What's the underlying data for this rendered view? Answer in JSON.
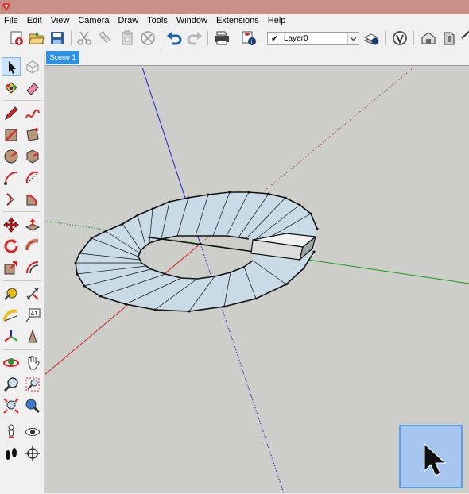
{
  "menu": [
    "File",
    "Edit",
    "View",
    "Camera",
    "Draw",
    "Tools",
    "Window",
    "Extensions",
    "Help"
  ],
  "toolbar": {
    "layer": {
      "name": "Layer0",
      "checked": true
    }
  },
  "scene_tabs": [
    {
      "label": "Scene 1"
    }
  ],
  "colors": {
    "axis_red": "#d02020",
    "axis_green": "#10a010",
    "axis_blue": "#2020c8",
    "face_fill": "#c8dbe6",
    "viewport_bg": "#cdcdc9",
    "scene_tab": "#2f8fe0",
    "title_bar": "#c99089"
  },
  "icons": {
    "top_toolbar": [
      "new-icon",
      "open-icon",
      "save-icon",
      "cut-icon",
      "copy-icon",
      "paste-icon",
      "erase-icon",
      "undo-icon",
      "redo-icon",
      "print-icon",
      "model-info-icon",
      "layer-manager-icon",
      "styles-icon",
      "warehouse-icon",
      "extension-icon",
      "home-icon"
    ],
    "left_toolbar": [
      "select-icon",
      "component-icon",
      "paint-bucket-icon",
      "eraser-icon",
      "pencil-icon",
      "freehand-icon",
      "rectangle-icon",
      "rotated-rectangle-icon",
      "circle-icon",
      "polygon-icon",
      "arc-icon",
      "two-point-arc-icon",
      "three-point-arc-icon",
      "pie-icon",
      "move-icon",
      "push-pull-icon",
      "rotate-icon",
      "follow-me-icon",
      "scale-icon",
      "offset-icon",
      "tape-measure-icon",
      "dimension-icon",
      "protractor-icon",
      "text-icon",
      "axes-icon",
      "3d-text-icon",
      "orbit-icon",
      "pan-icon",
      "zoom-icon",
      "zoom-window-icon",
      "zoom-extents-icon",
      "previous-view-icon",
      "position-camera-icon",
      "look-around-icon",
      "walk-icon",
      "section-plane-icon"
    ]
  }
}
